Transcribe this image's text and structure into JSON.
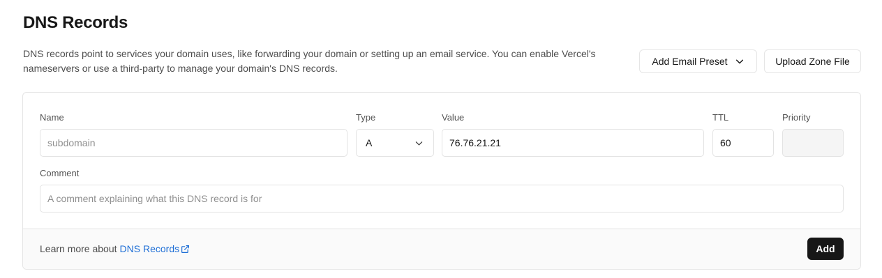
{
  "header": {
    "title": "DNS Records",
    "description": "DNS records point to services your domain uses, like forwarding your domain or setting up an email service. You can enable Vercel's nameservers or use a third-party to manage your domain's DNS records."
  },
  "actions": {
    "email_preset_label": "Add Email Preset",
    "upload_zone_label": "Upload Zone File"
  },
  "form": {
    "name": {
      "label": "Name",
      "placeholder": "subdomain",
      "value": ""
    },
    "type": {
      "label": "Type",
      "value": "A"
    },
    "value": {
      "label": "Value",
      "value": "76.76.21.21"
    },
    "ttl": {
      "label": "TTL",
      "value": "60"
    },
    "priority": {
      "label": "Priority",
      "value": ""
    },
    "comment": {
      "label": "Comment",
      "placeholder": "A comment explaining what this DNS record is for",
      "value": ""
    }
  },
  "footer": {
    "learn_prefix": "Learn more about",
    "learn_link": "DNS Records",
    "add_label": "Add"
  },
  "icons": {
    "dropdown": "chevron-down-icon",
    "external": "external-link-icon"
  },
  "colors": {
    "link": "#1f6fd6",
    "primary_button": "#171717"
  }
}
